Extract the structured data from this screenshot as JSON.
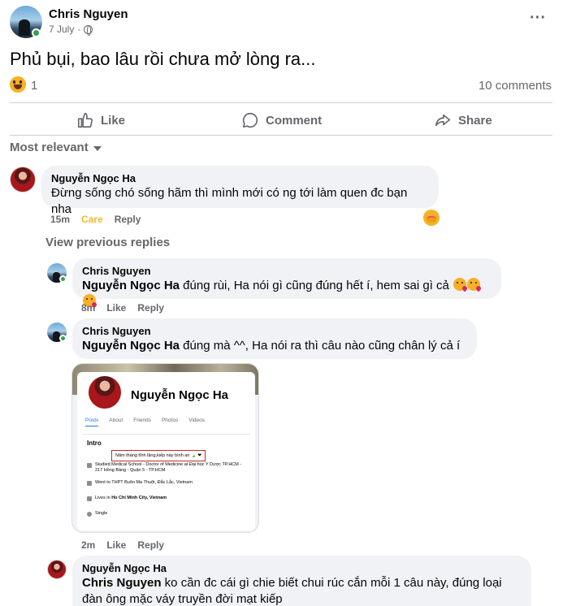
{
  "post": {
    "author": "Chris Nguyen",
    "date": "7 July",
    "dot": "·",
    "text": "Phủ bụi, bao lâu rồi chưa mở lòng ra...",
    "more_label": "···",
    "reaction_count": "1",
    "comments_count": "10 comments"
  },
  "actions": {
    "like": "Like",
    "comment": "Comment",
    "share": "Share"
  },
  "sort": {
    "label": "Most relevant"
  },
  "comments": [
    {
      "author": "Nguyễn Ngọc Ha",
      "text": "Đừng sống chó sống hãm thì mình mới có ng tới làm quen đc bạn nha",
      "time": "15m",
      "reaction": "Care",
      "reply": "Reply"
    }
  ],
  "view_previous": "View previous replies",
  "replies": [
    {
      "author": "Chris Nguyen",
      "tag": "Nguyễn Ngọc Ha",
      "text": " đúng rùi, Ha nói gì cũng đúng hết í, hem sai gì cả",
      "time": "8m",
      "like": "Like",
      "reply": "Reply"
    },
    {
      "author": "Chris Nguyen",
      "tag": "Nguyễn Ngọc Ha",
      "text": " đúng mà ^^, Ha nói ra thì câu nào cũng chân lý cả í",
      "time": "2m",
      "like": "Like",
      "reply": "Reply"
    },
    {
      "author": "Nguyễn Ngọc Ha",
      "tag": "Chris Nguyen",
      "text": " ko cần đc cái gì chie biết chui rúc cắn mỗi 1 câu này, đúng loại đàn ông mặc váy truyền đời mạt kiếp"
    }
  ],
  "attachment": {
    "profile_name": "Nguyễn Ngọc Ha",
    "tabs": [
      "Posts",
      "About",
      "Friends",
      "Photos",
      "Videos"
    ],
    "intro_title": "Intro",
    "bio": "Năm tháng tĩnh lặng,kiếp này bình an 🍃 ❤",
    "lines": [
      "Studied Medical School - Doctor of Medicine at Đại học Y Dược TP.HCM - 217 Hồng Bàng - Quận 5 - TP.HCM",
      "Went to THPT Buôn Ma Thuột, Đắc Lắc, Vietnam",
      "Ho Chi Minh City, Vietnam",
      "Single"
    ],
    "lives_prefix": "Lives in "
  },
  "colors": {
    "secondary_text": "#65676b",
    "bubble": "#f0f2f5",
    "care": "#f7b928",
    "online": "#31a24c"
  }
}
